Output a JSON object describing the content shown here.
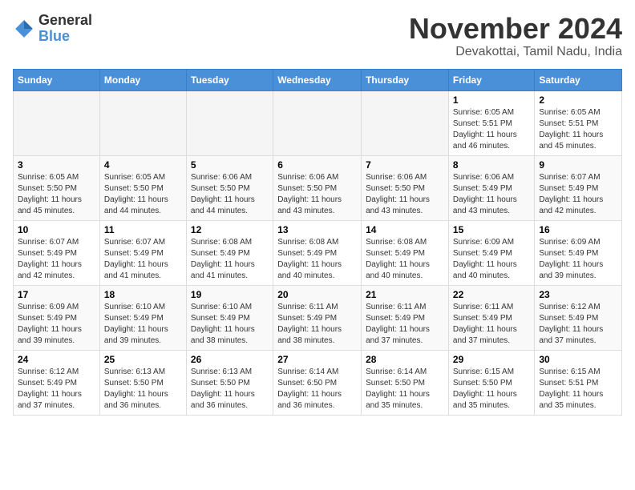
{
  "logo": {
    "text_general": "General",
    "text_blue": "Blue"
  },
  "header": {
    "month": "November 2024",
    "location": "Devakottai, Tamil Nadu, India"
  },
  "weekdays": [
    "Sunday",
    "Monday",
    "Tuesday",
    "Wednesday",
    "Thursday",
    "Friday",
    "Saturday"
  ],
  "weeks": [
    [
      {
        "day": "",
        "sunrise": "",
        "sunset": "",
        "daylight": ""
      },
      {
        "day": "",
        "sunrise": "",
        "sunset": "",
        "daylight": ""
      },
      {
        "day": "",
        "sunrise": "",
        "sunset": "",
        "daylight": ""
      },
      {
        "day": "",
        "sunrise": "",
        "sunset": "",
        "daylight": ""
      },
      {
        "day": "",
        "sunrise": "",
        "sunset": "",
        "daylight": ""
      },
      {
        "day": "1",
        "sunrise": "Sunrise: 6:05 AM",
        "sunset": "Sunset: 5:51 PM",
        "daylight": "Daylight: 11 hours and 46 minutes."
      },
      {
        "day": "2",
        "sunrise": "Sunrise: 6:05 AM",
        "sunset": "Sunset: 5:51 PM",
        "daylight": "Daylight: 11 hours and 45 minutes."
      }
    ],
    [
      {
        "day": "3",
        "sunrise": "Sunrise: 6:05 AM",
        "sunset": "Sunset: 5:50 PM",
        "daylight": "Daylight: 11 hours and 45 minutes."
      },
      {
        "day": "4",
        "sunrise": "Sunrise: 6:05 AM",
        "sunset": "Sunset: 5:50 PM",
        "daylight": "Daylight: 11 hours and 44 minutes."
      },
      {
        "day": "5",
        "sunrise": "Sunrise: 6:06 AM",
        "sunset": "Sunset: 5:50 PM",
        "daylight": "Daylight: 11 hours and 44 minutes."
      },
      {
        "day": "6",
        "sunrise": "Sunrise: 6:06 AM",
        "sunset": "Sunset: 5:50 PM",
        "daylight": "Daylight: 11 hours and 43 minutes."
      },
      {
        "day": "7",
        "sunrise": "Sunrise: 6:06 AM",
        "sunset": "Sunset: 5:50 PM",
        "daylight": "Daylight: 11 hours and 43 minutes."
      },
      {
        "day": "8",
        "sunrise": "Sunrise: 6:06 AM",
        "sunset": "Sunset: 5:49 PM",
        "daylight": "Daylight: 11 hours and 43 minutes."
      },
      {
        "day": "9",
        "sunrise": "Sunrise: 6:07 AM",
        "sunset": "Sunset: 5:49 PM",
        "daylight": "Daylight: 11 hours and 42 minutes."
      }
    ],
    [
      {
        "day": "10",
        "sunrise": "Sunrise: 6:07 AM",
        "sunset": "Sunset: 5:49 PM",
        "daylight": "Daylight: 11 hours and 42 minutes."
      },
      {
        "day": "11",
        "sunrise": "Sunrise: 6:07 AM",
        "sunset": "Sunset: 5:49 PM",
        "daylight": "Daylight: 11 hours and 41 minutes."
      },
      {
        "day": "12",
        "sunrise": "Sunrise: 6:08 AM",
        "sunset": "Sunset: 5:49 PM",
        "daylight": "Daylight: 11 hours and 41 minutes."
      },
      {
        "day": "13",
        "sunrise": "Sunrise: 6:08 AM",
        "sunset": "Sunset: 5:49 PM",
        "daylight": "Daylight: 11 hours and 40 minutes."
      },
      {
        "day": "14",
        "sunrise": "Sunrise: 6:08 AM",
        "sunset": "Sunset: 5:49 PM",
        "daylight": "Daylight: 11 hours and 40 minutes."
      },
      {
        "day": "15",
        "sunrise": "Sunrise: 6:09 AM",
        "sunset": "Sunset: 5:49 PM",
        "daylight": "Daylight: 11 hours and 40 minutes."
      },
      {
        "day": "16",
        "sunrise": "Sunrise: 6:09 AM",
        "sunset": "Sunset: 5:49 PM",
        "daylight": "Daylight: 11 hours and 39 minutes."
      }
    ],
    [
      {
        "day": "17",
        "sunrise": "Sunrise: 6:09 AM",
        "sunset": "Sunset: 5:49 PM",
        "daylight": "Daylight: 11 hours and 39 minutes."
      },
      {
        "day": "18",
        "sunrise": "Sunrise: 6:10 AM",
        "sunset": "Sunset: 5:49 PM",
        "daylight": "Daylight: 11 hours and 39 minutes."
      },
      {
        "day": "19",
        "sunrise": "Sunrise: 6:10 AM",
        "sunset": "Sunset: 5:49 PM",
        "daylight": "Daylight: 11 hours and 38 minutes."
      },
      {
        "day": "20",
        "sunrise": "Sunrise: 6:11 AM",
        "sunset": "Sunset: 5:49 PM",
        "daylight": "Daylight: 11 hours and 38 minutes."
      },
      {
        "day": "21",
        "sunrise": "Sunrise: 6:11 AM",
        "sunset": "Sunset: 5:49 PM",
        "daylight": "Daylight: 11 hours and 37 minutes."
      },
      {
        "day": "22",
        "sunrise": "Sunrise: 6:11 AM",
        "sunset": "Sunset: 5:49 PM",
        "daylight": "Daylight: 11 hours and 37 minutes."
      },
      {
        "day": "23",
        "sunrise": "Sunrise: 6:12 AM",
        "sunset": "Sunset: 5:49 PM",
        "daylight": "Daylight: 11 hours and 37 minutes."
      }
    ],
    [
      {
        "day": "24",
        "sunrise": "Sunrise: 6:12 AM",
        "sunset": "Sunset: 5:49 PM",
        "daylight": "Daylight: 11 hours and 37 minutes."
      },
      {
        "day": "25",
        "sunrise": "Sunrise: 6:13 AM",
        "sunset": "Sunset: 5:50 PM",
        "daylight": "Daylight: 11 hours and 36 minutes."
      },
      {
        "day": "26",
        "sunrise": "Sunrise: 6:13 AM",
        "sunset": "Sunset: 5:50 PM",
        "daylight": "Daylight: 11 hours and 36 minutes."
      },
      {
        "day": "27",
        "sunrise": "Sunrise: 6:14 AM",
        "sunset": "Sunset: 6:50 PM",
        "daylight": "Daylight: 11 hours and 36 minutes."
      },
      {
        "day": "28",
        "sunrise": "Sunrise: 6:14 AM",
        "sunset": "Sunset: 5:50 PM",
        "daylight": "Daylight: 11 hours and 35 minutes."
      },
      {
        "day": "29",
        "sunrise": "Sunrise: 6:15 AM",
        "sunset": "Sunset: 5:50 PM",
        "daylight": "Daylight: 11 hours and 35 minutes."
      },
      {
        "day": "30",
        "sunrise": "Sunrise: 6:15 AM",
        "sunset": "Sunset: 5:51 PM",
        "daylight": "Daylight: 11 hours and 35 minutes."
      }
    ]
  ]
}
